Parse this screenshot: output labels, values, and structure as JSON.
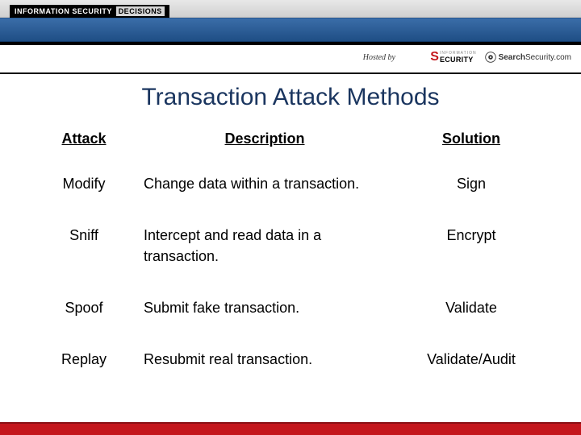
{
  "header": {
    "badge_left": "INFORMATION SECURITY",
    "badge_right": "DECISIONS",
    "hosted_by": "Hosted by",
    "sponsor1_top": "INFORMATION",
    "sponsor1_main": "ECURITY",
    "sponsor2_bold": "Search",
    "sponsor2_rest": "Security.com"
  },
  "slide": {
    "title": "Transaction Attack Methods",
    "columns": {
      "attack": "Attack",
      "description": "Description",
      "solution": "Solution"
    },
    "rows": [
      {
        "attack": "Modify",
        "description": "Change data within a transaction.",
        "solution": "Sign"
      },
      {
        "attack": "Sniff",
        "description": "Intercept and read data in a transaction.",
        "solution": "Encrypt"
      },
      {
        "attack": "Spoof",
        "description": "Submit fake transaction.",
        "solution": "Validate"
      },
      {
        "attack": "Replay",
        "description": "Resubmit real transaction.",
        "solution": "Validate/Audit"
      }
    ]
  }
}
